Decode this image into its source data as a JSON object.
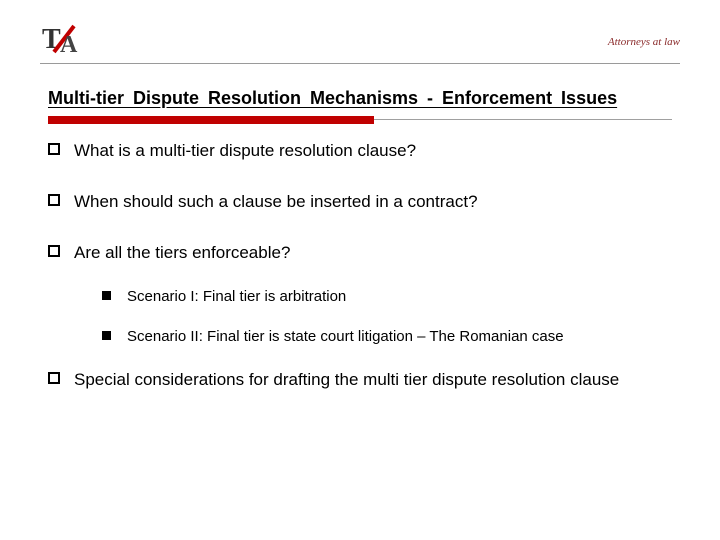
{
  "header": {
    "tagline": "Attorneys at law"
  },
  "title": "Multi-tier  Dispute  Resolution  Mechanisms - Enforcement  Issues",
  "bullets": [
    {
      "text": "What is a multi-tier dispute resolution clause?"
    },
    {
      "text": "When should such a clause be inserted in a contract?"
    },
    {
      "text": "Are all the tiers enforceable?",
      "children": [
        {
          "text": "Scenario I: Final tier is arbitration"
        },
        {
          "text": "Scenario II: Final tier is state court litigation – The Romanian case"
        }
      ]
    },
    {
      "text": "Special considerations for drafting the multi tier dispute resolution clause"
    }
  ]
}
